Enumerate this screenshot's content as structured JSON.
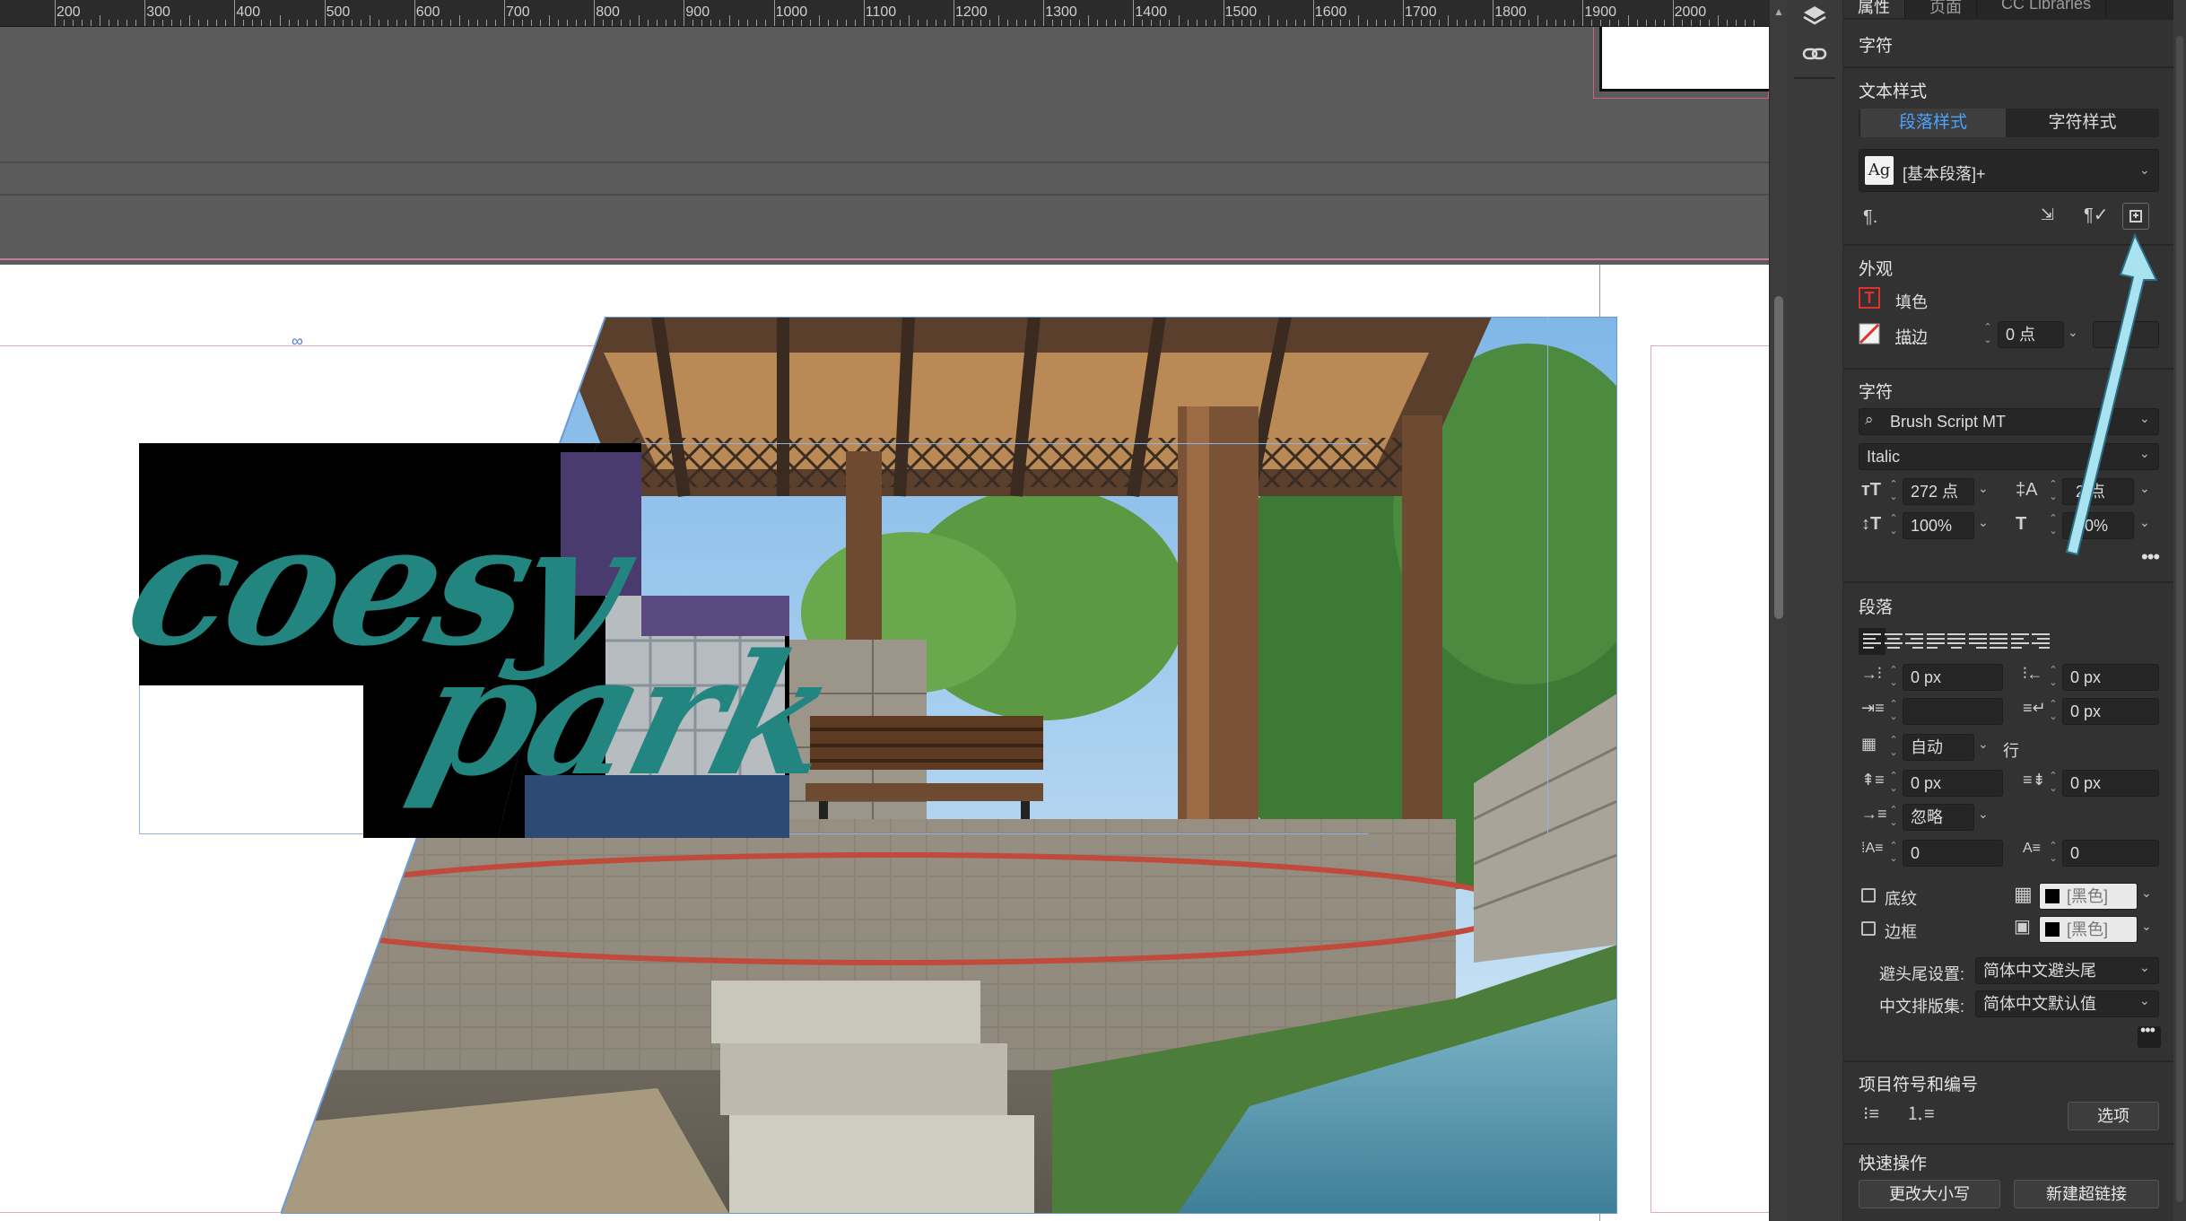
{
  "ruler": {
    "labels": [
      "200",
      "300",
      "400",
      "500",
      "600",
      "700",
      "800",
      "900",
      "1000",
      "1100",
      "1200",
      "1300",
      "1400",
      "1500",
      "1600",
      "1700",
      "1800",
      "1900",
      "2000"
    ]
  },
  "canvas": {
    "title_line1": "coesy",
    "title_line2": "park",
    "title_color": "#23857f"
  },
  "panel": {
    "tabs": [
      "属性",
      "页面",
      "CC Libraries"
    ],
    "section_character_top": "字符",
    "text_style": {
      "label": "文本样式",
      "para_tab": "段落样式",
      "char_tab": "字符样式",
      "style_value": "[基本段落]+",
      "style_icon": "Ag"
    },
    "appearance": {
      "label": "外观",
      "fill": "填色",
      "stroke": "描边",
      "stroke_weight": "0 点"
    },
    "character": {
      "label": "字符",
      "font": "Brush Script MT",
      "style": "Italic",
      "size": "272 点",
      "leading": "2 点",
      "vscale": "100%",
      "hscale": "00%"
    },
    "paragraph": {
      "label": "段落",
      "left_indent": "0 px",
      "right_indent": "0 px",
      "first_indent": "",
      "last_indent": "0 px",
      "grid": "自动",
      "grid_unit": "行",
      "space_before": "0 px",
      "space_after": "0 px",
      "align_grid": "忽略",
      "drop_lines": "0",
      "drop_chars": "0",
      "shading": "底纹",
      "shading_color": "[黑色]",
      "border": "边框",
      "border_color": "[黑色]",
      "kinsoku_label": "避头尾设置:",
      "kinsoku_value": "简体中文避头尾",
      "mojikumi_label": "中文排版集:",
      "mojikumi_value": "简体中文默认值"
    },
    "bullets": {
      "label": "项目符号和编号",
      "options": "选项"
    },
    "quick": {
      "label": "快速操作",
      "change_case": "更改大小写",
      "new_link": "新建超链接"
    }
  },
  "colors": {
    "panel_bg": "#323232",
    "accent_blue": "#4aa3ff",
    "arrow": "#a9e3f0",
    "fill_red": "#e0312e"
  }
}
